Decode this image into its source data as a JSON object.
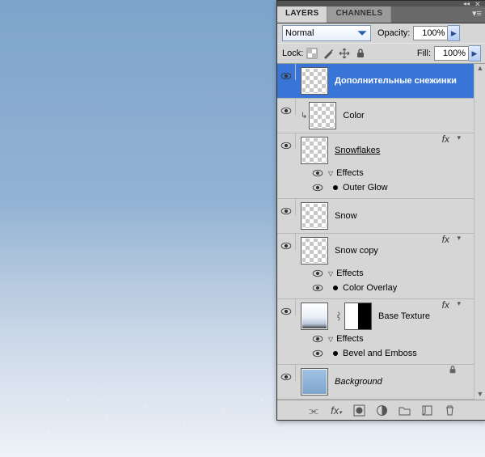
{
  "tabs": {
    "layers": "LAYERS",
    "channels": "CHANNELS"
  },
  "blend": {
    "mode": "Normal",
    "opacity_label": "Opacity:",
    "opacity_value": "100%",
    "lock_label": "Lock:",
    "fill_label": "Fill:",
    "fill_value": "100%"
  },
  "layers": [
    {
      "name": "Дополнительные снежинки",
      "selected": true,
      "thumb": "checker"
    },
    {
      "name": "Color",
      "clip": true,
      "thumb": "color-stripe"
    },
    {
      "name": "Snowflakes",
      "thumb": "checker",
      "underline": true,
      "fx": true,
      "effects_label": "Effects",
      "effects": [
        "Outer Glow"
      ]
    },
    {
      "name": "Snow",
      "thumb": "checker"
    },
    {
      "name": "Snow copy",
      "thumb": "checker",
      "fx": true,
      "effects_label": "Effects",
      "effects": [
        "Color Overlay"
      ]
    },
    {
      "name": "Base Texture",
      "thumb": "tex",
      "mask": true,
      "fx": true,
      "effects_label": "Effects",
      "effects": [
        "Bevel and Emboss"
      ]
    },
    {
      "name": "Background",
      "italic": true,
      "thumb": "grad",
      "locked": true
    }
  ]
}
